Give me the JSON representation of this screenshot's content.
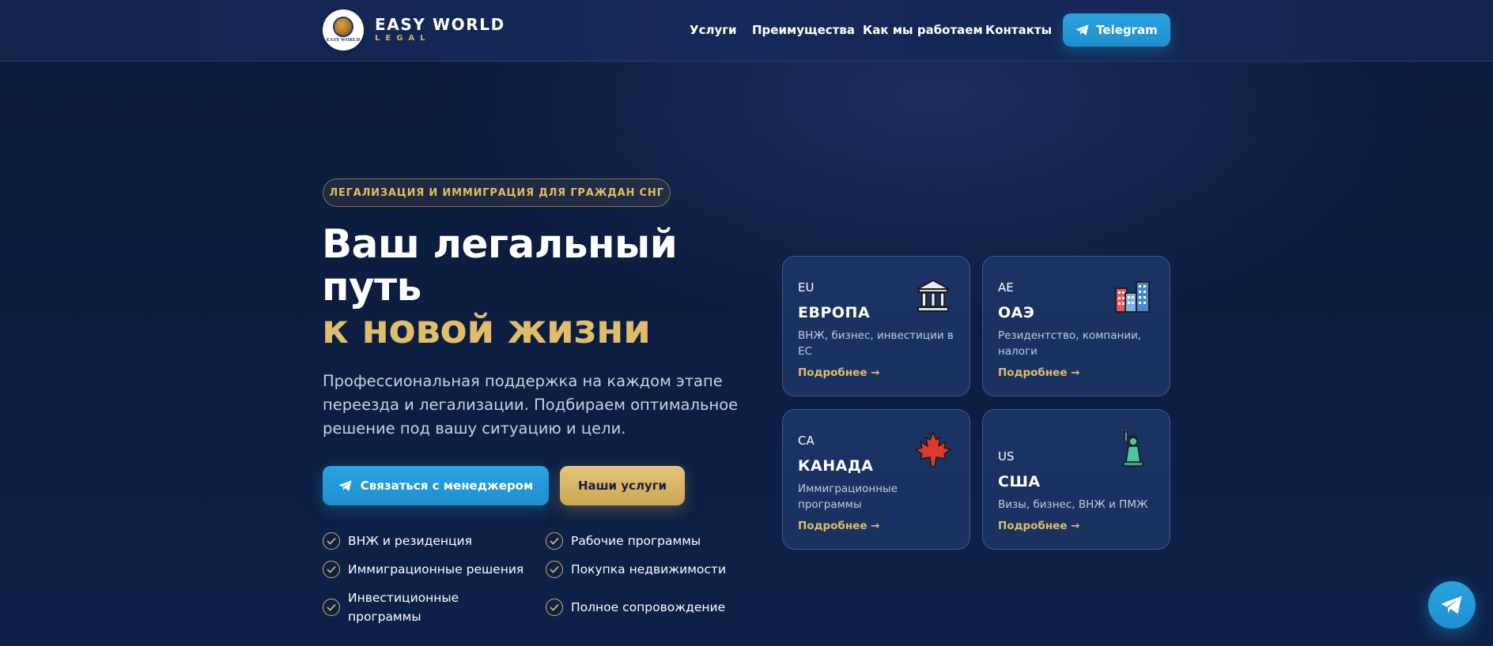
{
  "header": {
    "logo_title": "EASY WORLD",
    "logo_subtitle": "LEGAL",
    "logo_mini": "EASY WORLD",
    "nav": [
      "Услуги",
      "Преимущества",
      "Как мы работаем",
      "Контакты"
    ],
    "telegram_label": "Telegram"
  },
  "hero": {
    "badge": "ЛЕГАЛИЗАЦИЯ И ИММИГРАЦИЯ ДЛЯ ГРАЖДАН СНГ",
    "title_line1": "Ваш легальный",
    "title_line2": "путь",
    "title_line3": "к новой жизни",
    "lead_line1": "Профессиональная поддержка на каждом этапе",
    "lead_line2": "переезда и легализации. Подбираем оптимальное",
    "lead_line3": "решение под вашу ситуацию и цели.",
    "cta_primary": "Связаться с менеджером",
    "cta_secondary": "Наши услуги",
    "features": [
      {
        "line1": "ВНЖ и резиденция",
        "line2": ""
      },
      {
        "line1": "Рабочие программы",
        "line2": ""
      },
      {
        "line1": "Иммиграционные решения",
        "line2": ""
      },
      {
        "line1": "Покупка недвижимости",
        "line2": ""
      },
      {
        "line1": "Инвестиционные",
        "line2": "программы"
      },
      {
        "line1": "Полное сопровождение",
        "line2": ""
      }
    ]
  },
  "cards": [
    {
      "code": "EU",
      "title": "ЕВРОПА",
      "desc_line1": "ВНЖ, бизнес, инвестиции в",
      "desc_line2": "ЕС",
      "more": "Подробнее →",
      "icon": "bank-icon"
    },
    {
      "code": "AE",
      "title": "ОАЭ",
      "desc_line1": "Резидентство, компании,",
      "desc_line2": "налоги",
      "more": "Подробнее →",
      "icon": "city-buildings-icon"
    },
    {
      "code": "CA",
      "title": "КАНАДА",
      "desc_line1": "Иммиграционные",
      "desc_line2": "программы",
      "more": "Подробнее →",
      "icon": "maple-leaf-icon"
    },
    {
      "code": "US",
      "title": "США",
      "desc_line1": "Визы, бизнес, ВНЖ и ПМЖ",
      "desc_line2": "",
      "more": "Подробнее →",
      "icon": "statue-of-liberty-icon"
    }
  ],
  "colors": {
    "accent_blue": "#229ed9",
    "accent_gold": "#e0bd6a",
    "background": "#0c1d40",
    "card": "#1b3363"
  }
}
